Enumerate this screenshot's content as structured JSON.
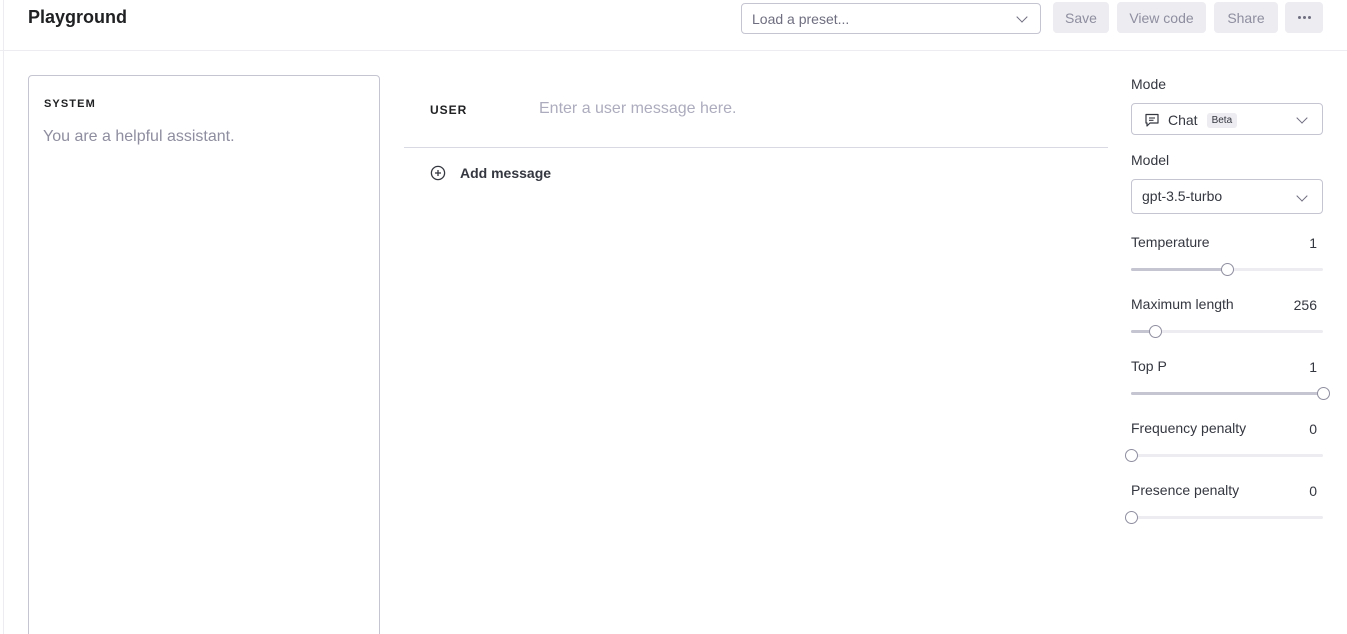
{
  "header": {
    "title": "Playground",
    "preset_placeholder": "Load a preset...",
    "save_label": "Save",
    "view_code_label": "View code",
    "share_label": "Share",
    "more_icon": "more-horizontal-icon"
  },
  "system": {
    "label": "SYSTEM",
    "placeholder": "You are a helpful assistant."
  },
  "chat": {
    "user_label": "USER",
    "user_placeholder": "Enter a user message here.",
    "add_message_label": "Add message",
    "add_message_icon": "plus-circle-icon"
  },
  "settings": {
    "mode_label": "Mode",
    "mode_value": "Chat",
    "mode_badge": "Beta",
    "mode_icon": "chat-bubble-icon",
    "model_label": "Model",
    "model_value": "gpt-3.5-turbo",
    "sliders": [
      {
        "label": "Temperature",
        "value": "1",
        "fraction": 0.5
      },
      {
        "label": "Maximum length",
        "value": "256",
        "fraction": 0.125
      },
      {
        "label": "Top P",
        "value": "1",
        "fraction": 1.0
      },
      {
        "label": "Frequency penalty",
        "value": "0",
        "fraction": 0.0
      },
      {
        "label": "Presence penalty",
        "value": "0",
        "fraction": 0.0
      }
    ]
  },
  "colors": {
    "border": "#c5c5d2",
    "button_bg": "#ececf1",
    "muted_text": "#8e8ea0"
  }
}
